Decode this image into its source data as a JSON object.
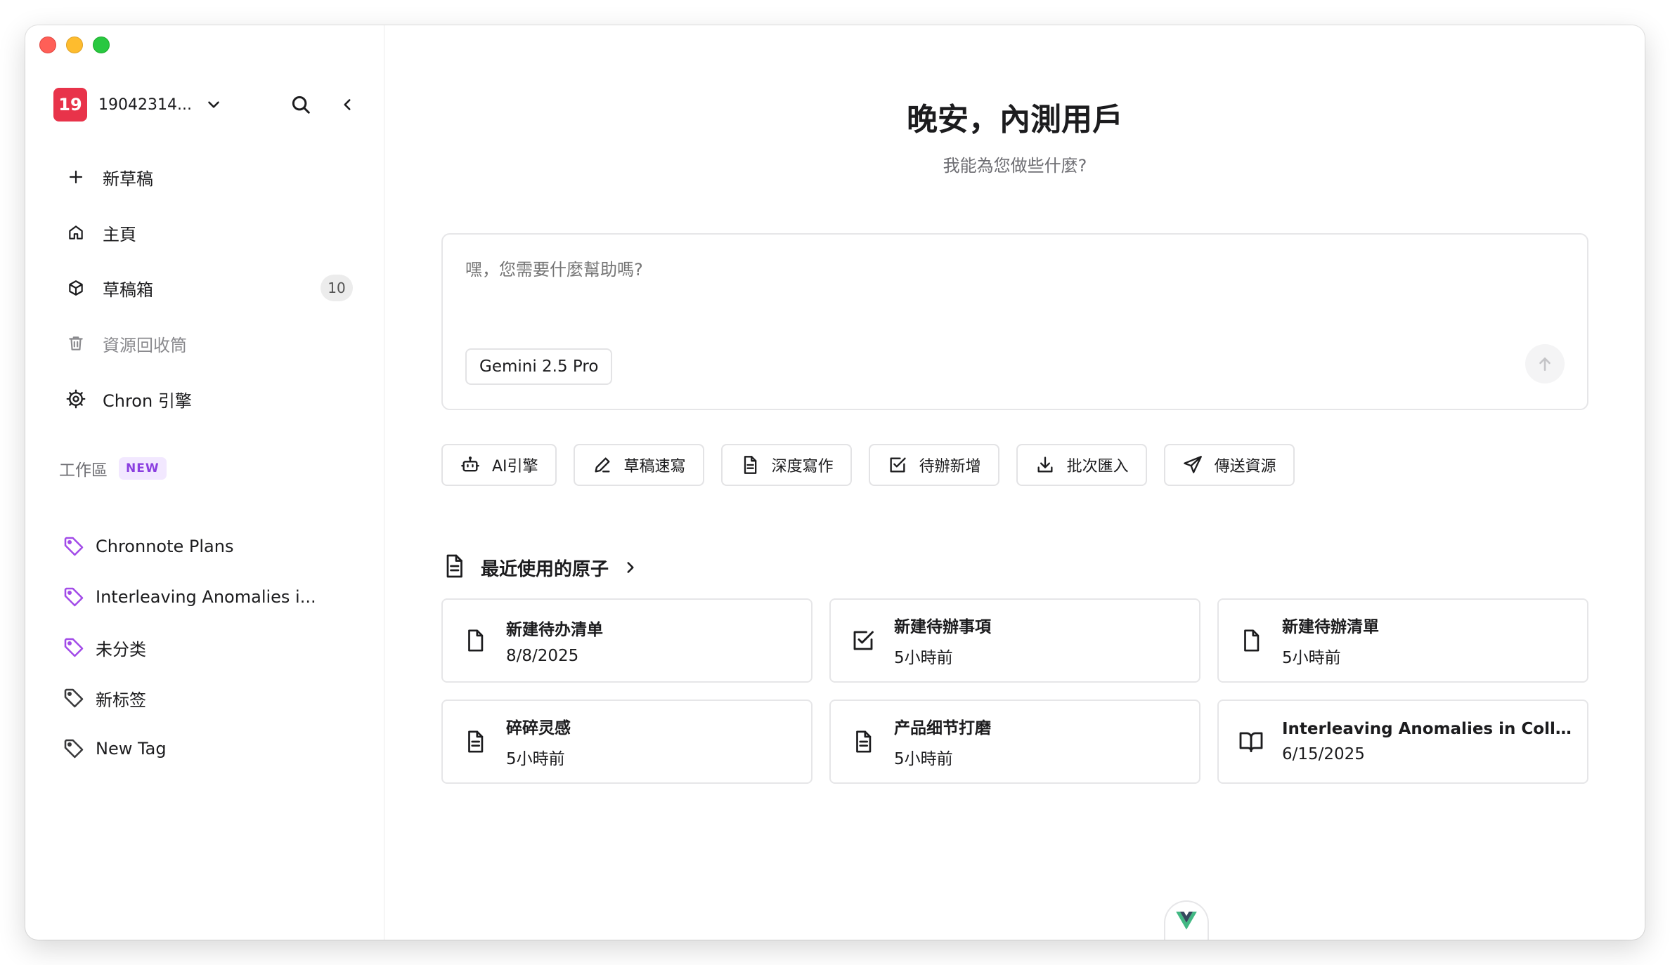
{
  "sidebar": {
    "account": {
      "badge": "19",
      "name": "19042314..."
    },
    "nav": [
      {
        "label": "新草稿",
        "icon": "plus-icon"
      },
      {
        "label": "主頁",
        "icon": "home-icon"
      },
      {
        "label": "草稿箱",
        "icon": "box-icon",
        "count": "10"
      },
      {
        "label": "資源回收筒",
        "icon": "trash-icon"
      },
      {
        "label": "Chron 引擎",
        "icon": "gear-icon"
      }
    ],
    "workspace": {
      "title": "工作區",
      "badge": "NEW"
    },
    "tags": [
      {
        "label": "Chronnote Plans",
        "color": "#a24be8"
      },
      {
        "label": "Interleaving Anomalies i...",
        "color": "#a24be8"
      },
      {
        "label": "未分类",
        "color": "#a24be8"
      },
      {
        "label": "新标签",
        "color": "#3a3a3c"
      },
      {
        "label": "New Tag",
        "color": "#3a3a3c"
      }
    ]
  },
  "main": {
    "greeting": "晚安，內測用戶",
    "subtitle": "我能為您做些什麼?",
    "composer": {
      "placeholder": "嘿，您需要什麼幫助嗎?",
      "model": "Gemini 2.5 Pro"
    },
    "actions": [
      {
        "label": "AI引擎",
        "icon": "robot-icon"
      },
      {
        "label": "草稿速寫",
        "icon": "pen-icon"
      },
      {
        "label": "深度寫作",
        "icon": "document-icon"
      },
      {
        "label": "待辦新增",
        "icon": "checkbox-icon"
      },
      {
        "label": "批次匯入",
        "icon": "download-icon"
      },
      {
        "label": "傳送資源",
        "icon": "send-icon"
      }
    ],
    "recent": {
      "title": "最近使用的原子",
      "items": [
        {
          "title": "新建待办清单",
          "date": "8/8/2025",
          "icon": "file-icon"
        },
        {
          "title": "新建待辦事項",
          "date": "5小時前",
          "icon": "checkbox-icon"
        },
        {
          "title": "新建待辦清單",
          "date": "5小時前",
          "icon": "file-icon"
        },
        {
          "title": "碎碎灵感",
          "date": "5小時前",
          "icon": "document-icon"
        },
        {
          "title": "产品细节打磨",
          "date": "5小時前",
          "icon": "document-icon"
        },
        {
          "title": "Interleaving Anomalies in Collabo...",
          "date": "6/15/2025",
          "icon": "book-icon"
        }
      ]
    }
  },
  "colors": {
    "accent": "#e8334a",
    "tag_purple": "#a24be8",
    "badge_purple": "#8b3fe0",
    "vue_green": "#41b883"
  }
}
